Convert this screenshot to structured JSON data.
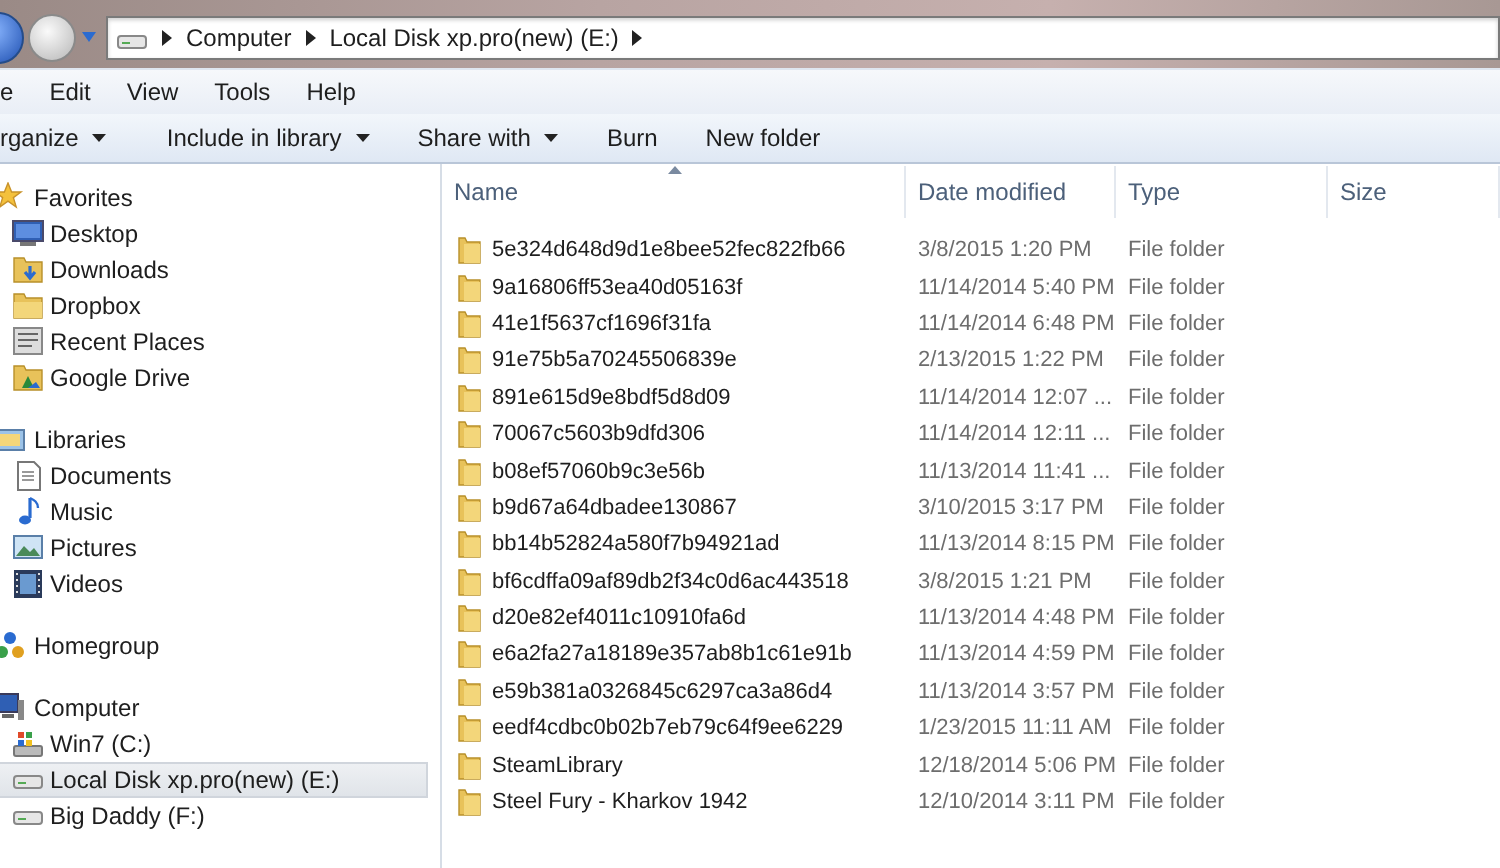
{
  "address_bar": {
    "path": [
      "Computer",
      "Local Disk xp.pro(new) (E:)"
    ]
  },
  "menu": [
    "e",
    "Edit",
    "View",
    "Tools",
    "Help"
  ],
  "toolbar": [
    {
      "label": "rganize",
      "dropdown": true
    },
    {
      "label": "Include in library",
      "dropdown": true
    },
    {
      "label": "Share with",
      "dropdown": true
    },
    {
      "label": "Burn",
      "dropdown": false
    },
    {
      "label": "New folder",
      "dropdown": false
    }
  ],
  "sidebar": {
    "groups": [
      {
        "label": "Favorites",
        "children": [
          {
            "label": "Desktop",
            "selected": false
          },
          {
            "label": "Downloads",
            "selected": false
          },
          {
            "label": "Dropbox",
            "selected": false
          },
          {
            "label": "Recent Places",
            "selected": false
          },
          {
            "label": "Google Drive",
            "selected": false
          }
        ]
      },
      {
        "label": "Libraries",
        "children": [
          {
            "label": "Documents",
            "selected": false
          },
          {
            "label": "Music",
            "selected": false
          },
          {
            "label": "Pictures",
            "selected": false
          },
          {
            "label": "Videos",
            "selected": false
          }
        ]
      },
      {
        "label": "Homegroup"
      },
      {
        "label": "Computer",
        "children": [
          {
            "label": "Win7 (C:)",
            "selected": false
          },
          {
            "label": "Local Disk xp.pro(new) (E:)",
            "selected": true
          },
          {
            "label": "Big Daddy (F:)",
            "selected": false
          }
        ]
      }
    ]
  },
  "file_list": {
    "columns": [
      {
        "label": "Name",
        "sorted": true
      },
      {
        "label": "Date modified",
        "sorted": false
      },
      {
        "label": "Type",
        "sorted": false
      },
      {
        "label": "Size",
        "sorted": false
      }
    ],
    "rows": [
      {
        "name": "5e324d648d9d1e8bee52fec822fb66",
        "date_modified": "3/8/2015 1:20 PM",
        "type": "File folder"
      },
      {
        "name": "9a16806ff53ea40d05163f",
        "date_modified": "11/14/2014 5:40 PM",
        "type": "File folder"
      },
      {
        "name": "41e1f5637cf1696f31fa",
        "date_modified": "11/14/2014 6:48 PM",
        "type": "File folder"
      },
      {
        "name": "91e75b5a70245506839e",
        "date_modified": "2/13/2015 1:22 PM",
        "type": "File folder"
      },
      {
        "name": "891e615d9e8bdf5d8d09",
        "date_modified": "11/14/2014 12:07 ...",
        "type": "File folder"
      },
      {
        "name": "70067c5603b9dfd306",
        "date_modified": "11/14/2014 12:11 ...",
        "type": "File folder"
      },
      {
        "name": "b08ef57060b9c3e56b",
        "date_modified": "11/13/2014 11:41 ...",
        "type": "File folder"
      },
      {
        "name": "b9d67a64dbadee130867",
        "date_modified": "3/10/2015 3:17 PM",
        "type": "File folder"
      },
      {
        "name": "bb14b52824a580f7b94921ad",
        "date_modified": "11/13/2014 8:15 PM",
        "type": "File folder"
      },
      {
        "name": "bf6cdffa09af89db2f34c0d6ac443518",
        "date_modified": "3/8/2015 1:21 PM",
        "type": "File folder"
      },
      {
        "name": "d20e82ef4011c10910fa6d",
        "date_modified": "11/13/2014 4:48 PM",
        "type": "File folder"
      },
      {
        "name": "e6a2fa27a18189e357ab8b1c61e91b",
        "date_modified": "11/13/2014 4:59 PM",
        "type": "File folder"
      },
      {
        "name": "e59b381a0326845c6297ca3a86d4",
        "date_modified": "11/13/2014 3:57 PM",
        "type": "File folder"
      },
      {
        "name": "eedf4cdbc0b02b7eb79c64f9ee6229",
        "date_modified": "1/23/2015 11:11 AM",
        "type": "File folder"
      },
      {
        "name": "SteamLibrary",
        "date_modified": "12/18/2014 5:06 PM",
        "type": "File folder"
      },
      {
        "name": "Steel Fury - Kharkov 1942",
        "date_modified": "12/10/2014 3:11 PM",
        "type": "File folder"
      }
    ]
  }
}
